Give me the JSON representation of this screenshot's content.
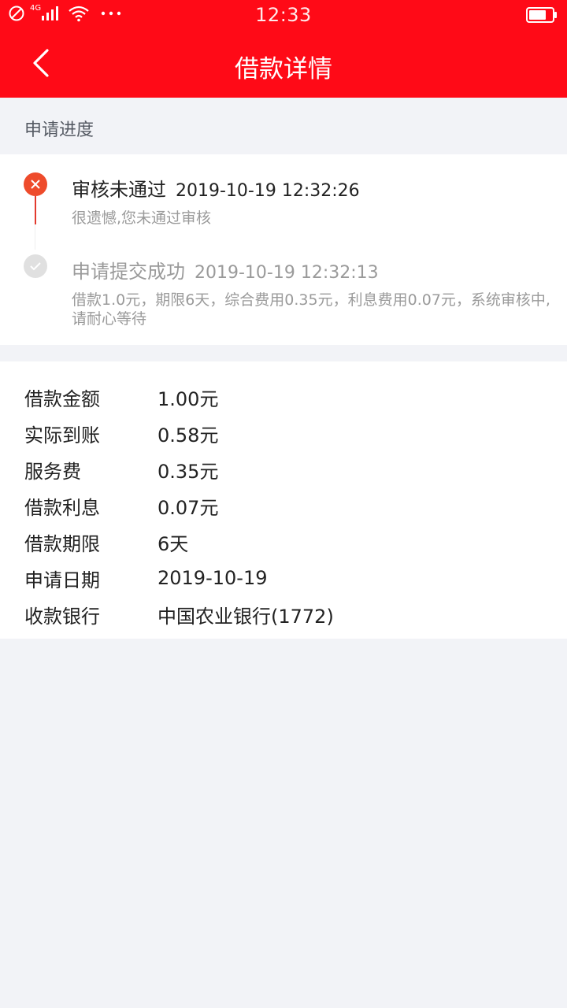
{
  "status_bar": {
    "time": "12:33",
    "network": "4G"
  },
  "header": {
    "title": "借款详情"
  },
  "progress": {
    "section_title": "申请进度",
    "steps": [
      {
        "title": "审核未通过",
        "time": "2019-10-19 12:32:26",
        "description": "很遗憾,您未通过审核"
      },
      {
        "title": "申请提交成功",
        "time": "2019-10-19 12:32:13",
        "description": "借款1.0元，期限6天，综合费用0.35元，利息费用0.07元，系统审核中,请耐心等待"
      }
    ]
  },
  "details": {
    "rows": [
      {
        "label": "借款金额",
        "value": "1.00元"
      },
      {
        "label": "实际到账",
        "value": "0.58元"
      },
      {
        "label": "服务费",
        "value": "0.35元"
      },
      {
        "label": "借款利息",
        "value": "0.07元"
      },
      {
        "label": "借款期限",
        "value": "6天"
      },
      {
        "label": "申请日期",
        "value": "2019-10-19"
      },
      {
        "label": "收款银行",
        "value": "中国农业银行(1772)"
      }
    ]
  },
  "colors": {
    "brand_red": "#ff0a17",
    "fail_red": "#ee4b2b",
    "background": "#f2f3f7"
  }
}
